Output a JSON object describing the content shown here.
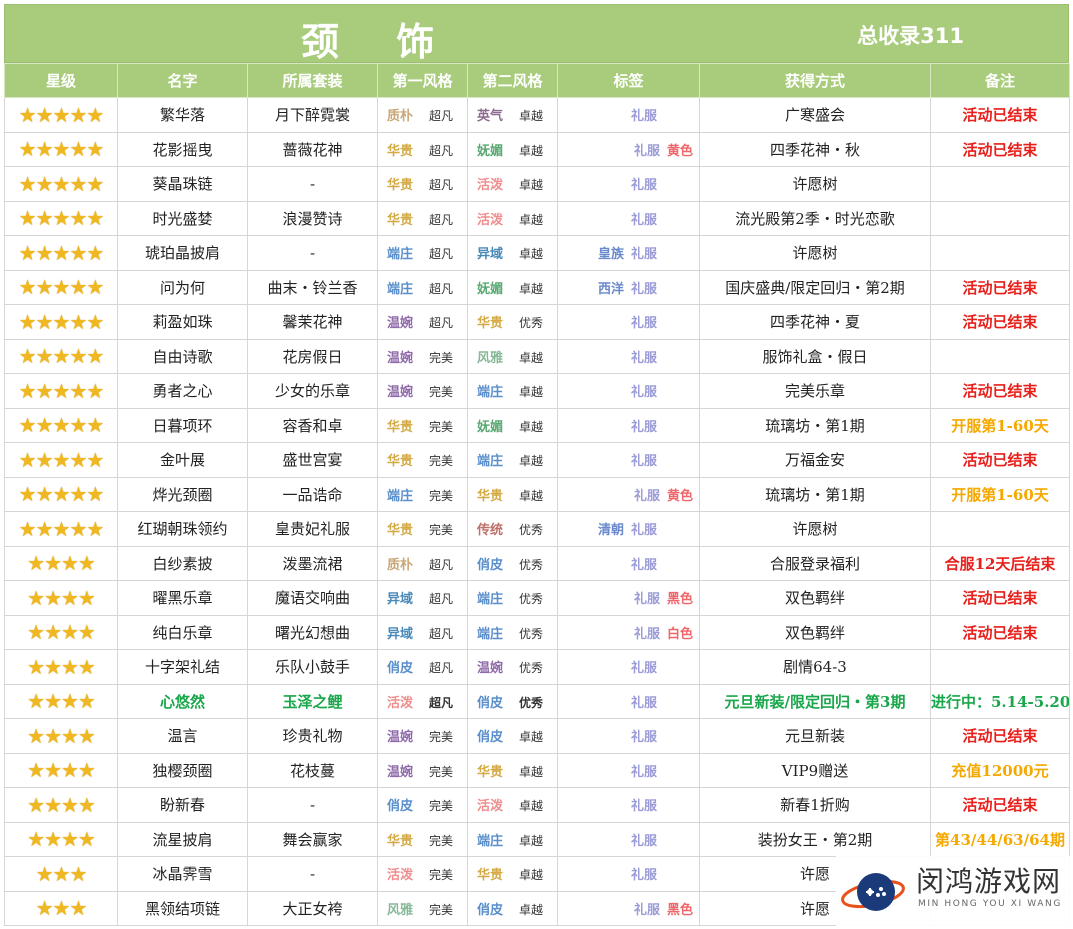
{
  "header": {
    "title": "颈 饰",
    "total": "总收录311"
  },
  "columns": [
    "星级",
    "名字",
    "所属套装",
    "第一风格",
    "第二风格",
    "标签",
    "获得方式",
    "备注"
  ],
  "colors": {
    "header_bg": "#a8cc7c",
    "red_note": "#e8201c",
    "orange_note": "#f5a800",
    "green_row": "#1aa64a",
    "star": "#f0b820"
  },
  "rows": [
    {
      "stars": "★★★★★",
      "name": "繁华落",
      "set": "月下醉霓裳",
      "s1": "质朴",
      "s1c": "#c8a878",
      "g1": "超凡",
      "s2": "英气",
      "s2c": "#8f6a8f",
      "g2": "卓越",
      "l1": "",
      "l1c": "",
      "l2": "礼服",
      "l2c": "#9b9bd8",
      "l3": "",
      "l3c": "",
      "source": "广寒盛会",
      "note": "活动已结束",
      "nc": "#e8201c",
      "hl": false
    },
    {
      "stars": "★★★★★",
      "name": "花影摇曳",
      "set": "蔷薇花神",
      "s1": "华贵",
      "s1c": "#d4aa44",
      "g1": "超凡",
      "s2": "妩媚",
      "s2c": "#5aa872",
      "g2": "卓越",
      "l1": "",
      "l1c": "",
      "l2": "礼服",
      "l2c": "#9b9bd8",
      "l3": "黄色",
      "l3c": "#f0666a",
      "source": "四季花神・秋",
      "note": "活动已结束",
      "nc": "#e8201c",
      "hl": false
    },
    {
      "stars": "★★★★★",
      "name": "葵晶珠链",
      "set": "-",
      "s1": "华贵",
      "s1c": "#d4aa44",
      "g1": "超凡",
      "s2": "活泼",
      "s2c": "#f08e8e",
      "g2": "卓越",
      "l1": "",
      "l1c": "",
      "l2": "礼服",
      "l2c": "#9b9bd8",
      "l3": "",
      "l3c": "",
      "source": "许愿树",
      "note": "",
      "nc": "#e8201c",
      "hl": false
    },
    {
      "stars": "★★★★★",
      "name": "时光盛婪",
      "set": "浪漫赞诗",
      "s1": "华贵",
      "s1c": "#d4aa44",
      "g1": "超凡",
      "s2": "活泼",
      "s2c": "#f08e8e",
      "g2": "卓越",
      "l1": "",
      "l1c": "",
      "l2": "礼服",
      "l2c": "#9b9bd8",
      "l3": "",
      "l3c": "",
      "source": "流光殿第2季・时光恋歌",
      "note": "",
      "nc": "#e8201c",
      "hl": false
    },
    {
      "stars": "★★★★★",
      "name": "琥珀晶披肩",
      "set": "-",
      "s1": "端庄",
      "s1c": "#5a8fcc",
      "g1": "超凡",
      "s2": "异域",
      "s2c": "#4a8ab8",
      "g2": "卓越",
      "l1": "皇族",
      "l1c": "#6a8acc",
      "l2": "礼服",
      "l2c": "#9b9bd8",
      "l3": "",
      "l3c": "",
      "source": "许愿树",
      "note": "",
      "nc": "#e8201c",
      "hl": false
    },
    {
      "stars": "★★★★★",
      "name": "问为何",
      "set": "曲末・铃兰香",
      "s1": "端庄",
      "s1c": "#5a8fcc",
      "g1": "超凡",
      "s2": "妩媚",
      "s2c": "#5aa872",
      "g2": "卓越",
      "l1": "西洋",
      "l1c": "#6a8acc",
      "l2": "礼服",
      "l2c": "#9b9bd8",
      "l3": "",
      "l3c": "",
      "source": "国庆盛典/限定回归・第2期",
      "note": "活动已结束",
      "nc": "#e8201c",
      "hl": false
    },
    {
      "stars": "★★★★★",
      "name": "莉盈如珠",
      "set": "馨茉花神",
      "s1": "温婉",
      "s1c": "#8f6aaa",
      "g1": "超凡",
      "s2": "华贵",
      "s2c": "#d4aa44",
      "g2": "优秀",
      "l1": "",
      "l1c": "",
      "l2": "礼服",
      "l2c": "#9b9bd8",
      "l3": "",
      "l3c": "",
      "source": "四季花神・夏",
      "note": "活动已结束",
      "nc": "#e8201c",
      "hl": false
    },
    {
      "stars": "★★★★★",
      "name": "自由诗歌",
      "set": "花房假日",
      "s1": "温婉",
      "s1c": "#8f6aaa",
      "g1": "完美",
      "s2": "风雅",
      "s2c": "#88b898",
      "g2": "卓越",
      "l1": "",
      "l1c": "",
      "l2": "礼服",
      "l2c": "#9b9bd8",
      "l3": "",
      "l3c": "",
      "source": "服饰礼盒・假日",
      "note": "",
      "nc": "#e8201c",
      "hl": false
    },
    {
      "stars": "★★★★★",
      "name": "勇者之心",
      "set": "少女的乐章",
      "s1": "温婉",
      "s1c": "#8f6aaa",
      "g1": "完美",
      "s2": "端庄",
      "s2c": "#5a8fcc",
      "g2": "卓越",
      "l1": "",
      "l1c": "",
      "l2": "礼服",
      "l2c": "#9b9bd8",
      "l3": "",
      "l3c": "",
      "source": "完美乐章",
      "note": "活动已结束",
      "nc": "#e8201c",
      "hl": false
    },
    {
      "stars": "★★★★★",
      "name": "日暮项环",
      "set": "容香和卓",
      "s1": "华贵",
      "s1c": "#d4aa44",
      "g1": "完美",
      "s2": "妩媚",
      "s2c": "#5aa872",
      "g2": "卓越",
      "l1": "",
      "l1c": "",
      "l2": "礼服",
      "l2c": "#9b9bd8",
      "l3": "",
      "l3c": "",
      "source": "琉璃坊・第1期",
      "note": "开服第1-60天",
      "nc": "#f5a800",
      "hl": false
    },
    {
      "stars": "★★★★★",
      "name": "金叶展",
      "set": "盛世宫宴",
      "s1": "华贵",
      "s1c": "#d4aa44",
      "g1": "完美",
      "s2": "端庄",
      "s2c": "#5a8fcc",
      "g2": "卓越",
      "l1": "",
      "l1c": "",
      "l2": "礼服",
      "l2c": "#9b9bd8",
      "l3": "",
      "l3c": "",
      "source": "万福金安",
      "note": "活动已结束",
      "nc": "#e8201c",
      "hl": false
    },
    {
      "stars": "★★★★★",
      "name": "烨光颈圈",
      "set": "一品诰命",
      "s1": "端庄",
      "s1c": "#5a8fcc",
      "g1": "完美",
      "s2": "华贵",
      "s2c": "#d4aa44",
      "g2": "卓越",
      "l1": "",
      "l1c": "",
      "l2": "礼服",
      "l2c": "#9b9bd8",
      "l3": "黄色",
      "l3c": "#f0666a",
      "source": "琉璃坊・第1期",
      "note": "开服第1-60天",
      "nc": "#f5a800",
      "hl": false
    },
    {
      "stars": "★★★★★",
      "name": "红瑚朝珠领约",
      "set": "皇贵妃礼服",
      "s1": "华贵",
      "s1c": "#d4aa44",
      "g1": "完美",
      "s2": "传统",
      "s2c": "#c0706a",
      "g2": "优秀",
      "l1": "清朝",
      "l1c": "#6a8acc",
      "l2": "礼服",
      "l2c": "#9b9bd8",
      "l3": "",
      "l3c": "",
      "source": "许愿树",
      "note": "",
      "nc": "#e8201c",
      "hl": false
    },
    {
      "stars": "★★★★",
      "name": "白纱素披",
      "set": "泼墨流裙",
      "s1": "质朴",
      "s1c": "#c8a878",
      "g1": "超凡",
      "s2": "俏皮",
      "s2c": "#5a8fcc",
      "g2": "优秀",
      "l1": "",
      "l1c": "",
      "l2": "礼服",
      "l2c": "#9b9bd8",
      "l3": "",
      "l3c": "",
      "source": "合服登录福利",
      "note": "合服12天后结束",
      "nc": "#e8201c",
      "hl": false
    },
    {
      "stars": "★★★★",
      "name": "曜黑乐章",
      "set": "魔语交响曲",
      "s1": "异域",
      "s1c": "#4a8ab8",
      "g1": "超凡",
      "s2": "端庄",
      "s2c": "#5a8fcc",
      "g2": "优秀",
      "l1": "",
      "l1c": "",
      "l2": "礼服",
      "l2c": "#9b9bd8",
      "l3": "黑色",
      "l3c": "#f0666a",
      "source": "双色羁绊",
      "note": "活动已结束",
      "nc": "#e8201c",
      "hl": false
    },
    {
      "stars": "★★★★",
      "name": "纯白乐章",
      "set": "曙光幻想曲",
      "s1": "异域",
      "s1c": "#4a8ab8",
      "g1": "超凡",
      "s2": "端庄",
      "s2c": "#5a8fcc",
      "g2": "优秀",
      "l1": "",
      "l1c": "",
      "l2": "礼服",
      "l2c": "#9b9bd8",
      "l3": "白色",
      "l3c": "#f0666a",
      "source": "双色羁绊",
      "note": "活动已结束",
      "nc": "#e8201c",
      "hl": false
    },
    {
      "stars": "★★★★",
      "name": "十字架礼结",
      "set": "乐队小鼓手",
      "s1": "俏皮",
      "s1c": "#5a8fcc",
      "g1": "超凡",
      "s2": "温婉",
      "s2c": "#8f6aaa",
      "g2": "优秀",
      "l1": "",
      "l1c": "",
      "l2": "礼服",
      "l2c": "#9b9bd8",
      "l3": "",
      "l3c": "",
      "source": "剧情64-3",
      "note": "",
      "nc": "#e8201c",
      "hl": false
    },
    {
      "stars": "★★★★",
      "name": "心悠然",
      "set": "玉泽之鲤",
      "s1": "活泼",
      "s1c": "#f08e8e",
      "g1": "超凡",
      "s2": "俏皮",
      "s2c": "#5a8fcc",
      "g2": "优秀",
      "l1": "",
      "l1c": "",
      "l2": "礼服",
      "l2c": "#9b9bd8",
      "l3": "",
      "l3c": "",
      "source": "元旦新装/限定回归・第3期",
      "note": "进行中：5.14-5.20",
      "nc": "#1aa64a",
      "hl": true
    },
    {
      "stars": "★★★★",
      "name": "温言",
      "set": "珍贵礼物",
      "s1": "温婉",
      "s1c": "#8f6aaa",
      "g1": "完美",
      "s2": "俏皮",
      "s2c": "#5a8fcc",
      "g2": "卓越",
      "l1": "",
      "l1c": "",
      "l2": "礼服",
      "l2c": "#9b9bd8",
      "l3": "",
      "l3c": "",
      "source": "元旦新装",
      "note": "活动已结束",
      "nc": "#e8201c",
      "hl": false
    },
    {
      "stars": "★★★★",
      "name": "独樱颈圈",
      "set": "花枝蔓",
      "s1": "温婉",
      "s1c": "#8f6aaa",
      "g1": "完美",
      "s2": "华贵",
      "s2c": "#d4aa44",
      "g2": "卓越",
      "l1": "",
      "l1c": "",
      "l2": "礼服",
      "l2c": "#9b9bd8",
      "l3": "",
      "l3c": "",
      "source": "VIP9赠送",
      "note": "充值12000元",
      "nc": "#f5a800",
      "hl": false
    },
    {
      "stars": "★★★★",
      "name": "盼新春",
      "set": "-",
      "s1": "俏皮",
      "s1c": "#5a8fcc",
      "g1": "完美",
      "s2": "活泼",
      "s2c": "#f08e8e",
      "g2": "卓越",
      "l1": "",
      "l1c": "",
      "l2": "礼服",
      "l2c": "#9b9bd8",
      "l3": "",
      "l3c": "",
      "source": "新春1折购",
      "note": "活动已结束",
      "nc": "#e8201c",
      "hl": false
    },
    {
      "stars": "★★★★",
      "name": "流星披肩",
      "set": "舞会赢家",
      "s1": "华贵",
      "s1c": "#d4aa44",
      "g1": "完美",
      "s2": "端庄",
      "s2c": "#5a8fcc",
      "g2": "卓越",
      "l1": "",
      "l1c": "",
      "l2": "礼服",
      "l2c": "#9b9bd8",
      "l3": "",
      "l3c": "",
      "source": "装扮女王・第2期",
      "note": "第43/44/63/64期",
      "nc": "#f5a800",
      "hl": false
    },
    {
      "stars": "★★★",
      "name": "冰晶霁雪",
      "set": "-",
      "s1": "活泼",
      "s1c": "#f08e8e",
      "g1": "完美",
      "s2": "华贵",
      "s2c": "#d4aa44",
      "g2": "卓越",
      "l1": "",
      "l1c": "",
      "l2": "礼服",
      "l2c": "#9b9bd8",
      "l3": "",
      "l3c": "",
      "source": "许愿",
      "note": "",
      "nc": "#e8201c",
      "hl": false
    },
    {
      "stars": "★★★",
      "name": "黑领结项链",
      "set": "大正女袴",
      "s1": "风雅",
      "s1c": "#88b898",
      "g1": "完美",
      "s2": "俏皮",
      "s2c": "#5a8fcc",
      "g2": "卓越",
      "l1": "",
      "l1c": "",
      "l2": "礼服",
      "l2c": "#9b9bd8",
      "l3": "黑色",
      "l3c": "#f0666a",
      "source": "许愿",
      "note": "",
      "nc": "#e8201c",
      "hl": false
    }
  ],
  "watermark": {
    "name": "闵鸿游戏网",
    "sub": "MIN HONG YOU XI WANG"
  }
}
